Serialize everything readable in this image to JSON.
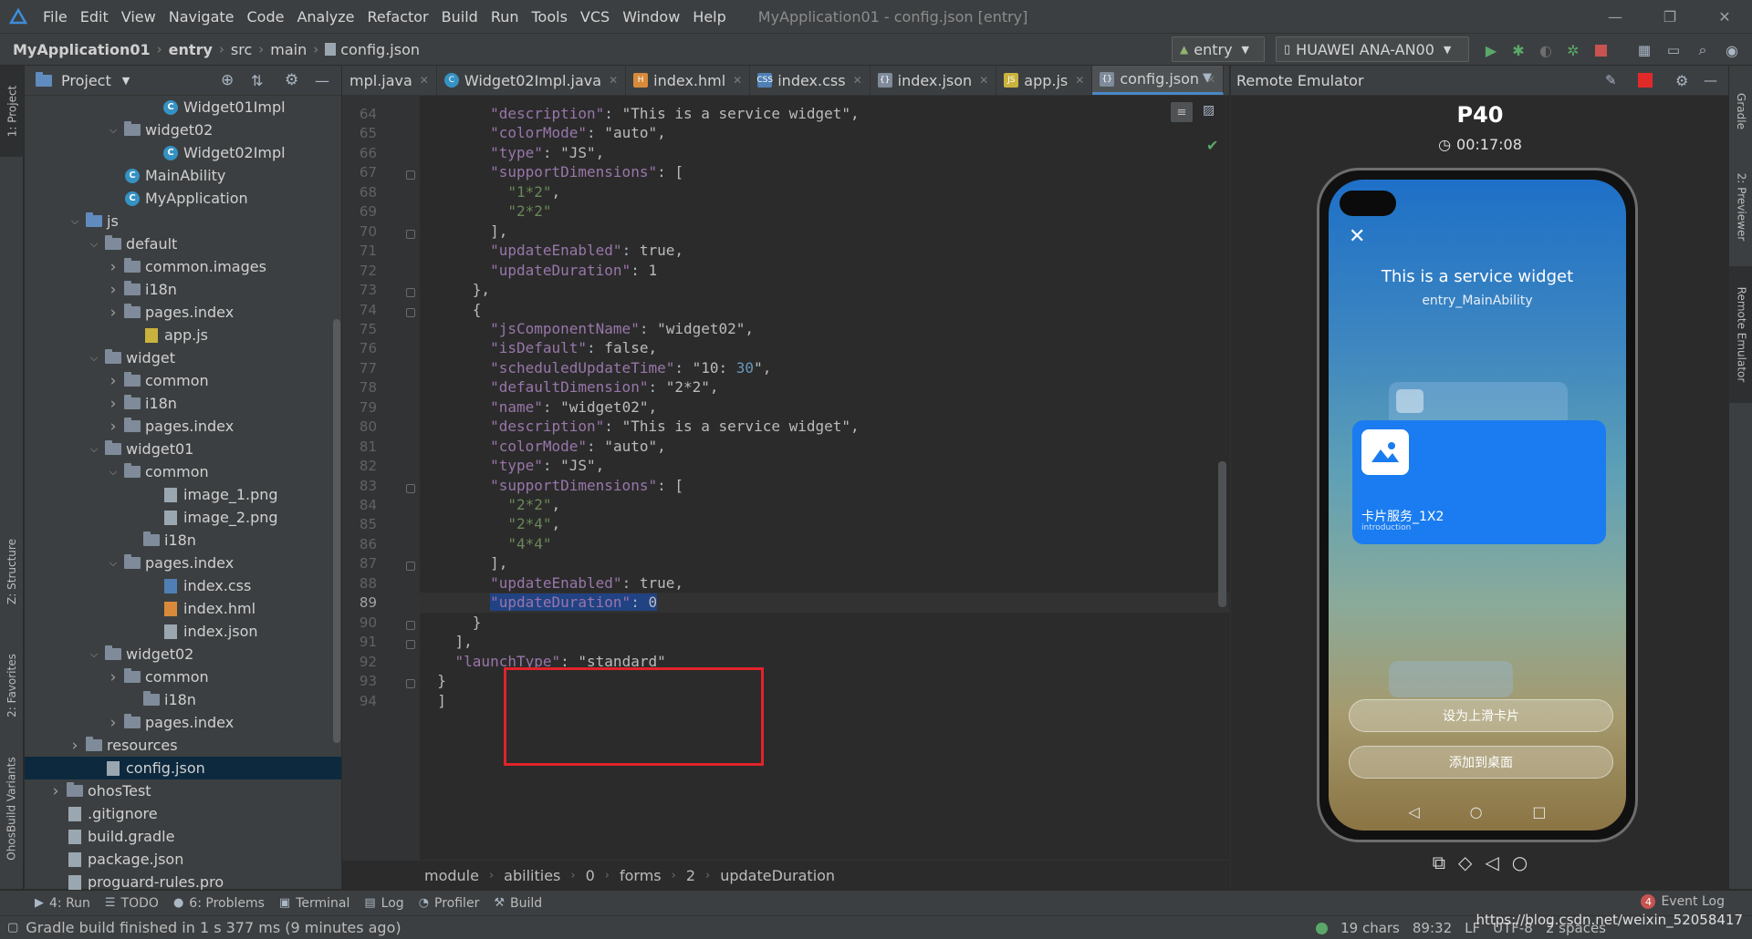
{
  "menubar": {
    "items": [
      "File",
      "Edit",
      "View",
      "Navigate",
      "Code",
      "Analyze",
      "Refactor",
      "Build",
      "Run",
      "Tools",
      "VCS",
      "Window",
      "Help"
    ],
    "window_title": "MyApplication01 - config.json [entry]"
  },
  "navbar": {
    "crumbs": [
      "MyApplication01",
      "entry",
      "src",
      "main",
      "config.json"
    ],
    "config_combo": "entry",
    "device_combo": "HUAWEI ANA-AN00"
  },
  "project_panel": {
    "title": "Project",
    "tree": [
      {
        "label": "Widget01Impl",
        "indent": 8,
        "arrow": "",
        "icon": "class"
      },
      {
        "label": "widget02",
        "indent": 6,
        "arrow": "v",
        "icon": "folder"
      },
      {
        "label": "Widget02Impl",
        "indent": 8,
        "arrow": "",
        "icon": "class"
      },
      {
        "label": "MainAbility",
        "indent": 6,
        "arrow": "",
        "icon": "class"
      },
      {
        "label": "MyApplication",
        "indent": 6,
        "arrow": "",
        "icon": "class"
      },
      {
        "label": "js",
        "indent": 4,
        "arrow": "v",
        "icon": "folder-blue"
      },
      {
        "label": "default",
        "indent": 5,
        "arrow": "v",
        "icon": "folder"
      },
      {
        "label": "common.images",
        "indent": 6,
        "arrow": ">",
        "icon": "folder"
      },
      {
        "label": "i18n",
        "indent": 6,
        "arrow": ">",
        "icon": "folder"
      },
      {
        "label": "pages.index",
        "indent": 6,
        "arrow": ">",
        "icon": "folder"
      },
      {
        "label": "app.js",
        "indent": 7,
        "arrow": "",
        "icon": "file-yellow"
      },
      {
        "label": "widget",
        "indent": 5,
        "arrow": "v",
        "icon": "folder"
      },
      {
        "label": "common",
        "indent": 6,
        "arrow": ">",
        "icon": "folder"
      },
      {
        "label": "i18n",
        "indent": 6,
        "arrow": ">",
        "icon": "folder"
      },
      {
        "label": "pages.index",
        "indent": 6,
        "arrow": ">",
        "icon": "folder"
      },
      {
        "label": "widget01",
        "indent": 5,
        "arrow": "v",
        "icon": "folder"
      },
      {
        "label": "common",
        "indent": 6,
        "arrow": "v",
        "icon": "folder"
      },
      {
        "label": "image_1.png",
        "indent": 8,
        "arrow": "",
        "icon": "file"
      },
      {
        "label": "image_2.png",
        "indent": 8,
        "arrow": "",
        "icon": "file"
      },
      {
        "label": "i18n",
        "indent": 7,
        "arrow": "",
        "icon": "folder"
      },
      {
        "label": "pages.index",
        "indent": 6,
        "arrow": "v",
        "icon": "folder"
      },
      {
        "label": "index.css",
        "indent": 8,
        "arrow": "",
        "icon": "file-blue"
      },
      {
        "label": "index.hml",
        "indent": 8,
        "arrow": "",
        "icon": "file-orange"
      },
      {
        "label": "index.json",
        "indent": 8,
        "arrow": "",
        "icon": "file"
      },
      {
        "label": "widget02",
        "indent": 5,
        "arrow": "v",
        "icon": "folder"
      },
      {
        "label": "common",
        "indent": 6,
        "arrow": ">",
        "icon": "folder"
      },
      {
        "label": "i18n",
        "indent": 7,
        "arrow": "",
        "icon": "folder"
      },
      {
        "label": "pages.index",
        "indent": 6,
        "arrow": ">",
        "icon": "folder"
      },
      {
        "label": "resources",
        "indent": 4,
        "arrow": ">",
        "icon": "folder"
      },
      {
        "label": "config.json",
        "indent": 5,
        "arrow": "",
        "icon": "file",
        "selected": true
      },
      {
        "label": "ohosTest",
        "indent": 3,
        "arrow": ">",
        "icon": "folder"
      },
      {
        "label": ".gitignore",
        "indent": 3,
        "arrow": "",
        "icon": "file"
      },
      {
        "label": "build.gradle",
        "indent": 3,
        "arrow": "",
        "icon": "file"
      },
      {
        "label": "package.json",
        "indent": 3,
        "arrow": "",
        "icon": "file"
      },
      {
        "label": "proguard-rules.pro",
        "indent": 3,
        "arrow": "",
        "icon": "file"
      }
    ]
  },
  "editor_tabs": [
    {
      "label": "mpl.java",
      "icon": "none"
    },
    {
      "label": "Widget02Impl.java",
      "icon": "class"
    },
    {
      "label": "index.hml",
      "icon": "hml"
    },
    {
      "label": "index.css",
      "icon": "css"
    },
    {
      "label": "index.json",
      "icon": "json"
    },
    {
      "label": "app.js",
      "icon": "js"
    },
    {
      "label": "config.json",
      "icon": "json",
      "active": true
    }
  ],
  "code_lines": [
    {
      "num": "64",
      "text": "        \"description\": \"This is a service widget\","
    },
    {
      "num": "65",
      "text": "        \"colorMode\": \"auto\","
    },
    {
      "num": "66",
      "text": "        \"type\": \"JS\","
    },
    {
      "num": "67",
      "text": "        \"supportDimensions\": ["
    },
    {
      "num": "68",
      "text": "          \"1*2\","
    },
    {
      "num": "69",
      "text": "          \"2*2\""
    },
    {
      "num": "70",
      "text": "        ],"
    },
    {
      "num": "71",
      "text": "        \"updateEnabled\": true,"
    },
    {
      "num": "72",
      "text": "        \"updateDuration\": 1"
    },
    {
      "num": "73",
      "text": "      },"
    },
    {
      "num": "74",
      "text": "      {"
    },
    {
      "num": "75",
      "text": "        \"jsComponentName\": \"widget02\","
    },
    {
      "num": "76",
      "text": "        \"isDefault\": false,"
    },
    {
      "num": "77",
      "text": "        \"scheduledUpdateTime\": \"10:30\","
    },
    {
      "num": "78",
      "text": "        \"defaultDimension\": \"2*2\","
    },
    {
      "num": "79",
      "text": "        \"name\": \"widget02\","
    },
    {
      "num": "80",
      "text": "        \"description\": \"This is a service widget\","
    },
    {
      "num": "81",
      "text": "        \"colorMode\": \"auto\","
    },
    {
      "num": "82",
      "text": "        \"type\": \"JS\","
    },
    {
      "num": "83",
      "text": "        \"supportDimensions\": ["
    },
    {
      "num": "84",
      "text": "          \"2*2\","
    },
    {
      "num": "85",
      "text": "          \"2*4\","
    },
    {
      "num": "86",
      "text": "          \"4*4\""
    },
    {
      "num": "87",
      "text": "        ],"
    },
    {
      "num": "88",
      "text": "        \"updateEnabled\": true,"
    },
    {
      "num": "89",
      "text": "        \"updateDuration\": 0",
      "current": true
    },
    {
      "num": "90",
      "text": "      }"
    },
    {
      "num": "91",
      "text": "    ],"
    },
    {
      "num": "92",
      "text": "    \"launchType\": \"standard\""
    },
    {
      "num": "93",
      "text": "  }"
    },
    {
      "num": "94",
      "text": "  ]"
    }
  ],
  "breadcrumb_footer": [
    "module",
    "abilities",
    "0",
    "forms",
    "2",
    "updateDuration"
  ],
  "emulator": {
    "panel_title": "Remote Emulator",
    "device": "P40",
    "timer": "00:17:08",
    "widget_title": "This is a service widget",
    "widget_subtitle": "entry_MainAbility",
    "card_title": "卡片服务_1X2",
    "card_subtitle": "introduction",
    "btn_set_card": "设为上滑卡片",
    "btn_add_desktop": "添加到桌面"
  },
  "left_strip": {
    "project": "1: Project",
    "structure": "Z: Structure",
    "favorites": "2: Favorites",
    "variants": "OhosBuild Variants"
  },
  "right_strip": {
    "gradle": "Gradle",
    "previewer": "2: Previewer",
    "emulator": "Remote Emulator"
  },
  "bottom_tools": [
    {
      "label": "4: Run",
      "icon": "▶"
    },
    {
      "label": "TODO",
      "icon": "☰"
    },
    {
      "label": "6: Problems",
      "icon": "●"
    },
    {
      "label": "Terminal",
      "icon": "▣"
    },
    {
      "label": "Log",
      "icon": "▤"
    },
    {
      "label": "Profiler",
      "icon": "◔"
    },
    {
      "label": "Build",
      "icon": "⚒"
    }
  ],
  "event_log": {
    "count": "4",
    "label": "Event Log"
  },
  "status": {
    "message": "Gradle build finished in 1 s 377 ms (9 minutes ago)",
    "chars": "19 chars",
    "position": "89:32",
    "line_sep": "LF",
    "encoding": "UTF-8",
    "indent": "2 spaces"
  },
  "watermark": "https://blog.csdn.net/weixin_52058417"
}
